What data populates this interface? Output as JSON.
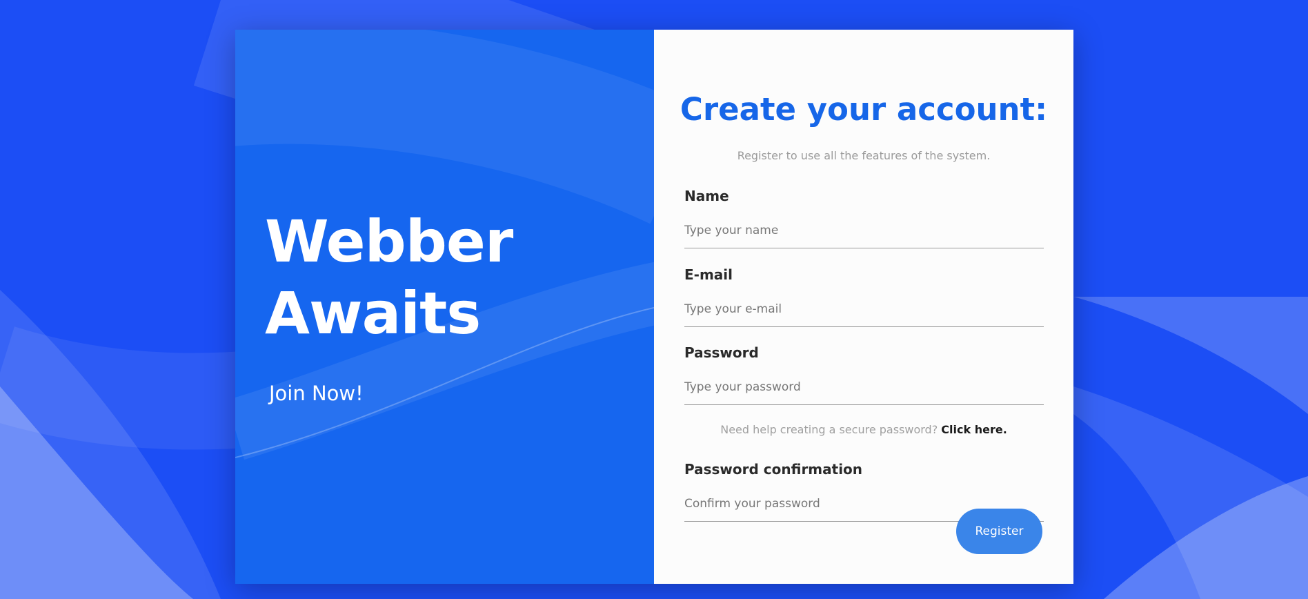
{
  "hero": {
    "title_line1": "Webber",
    "title_line2": "Awaits",
    "subtitle": "Join Now!"
  },
  "form": {
    "title": "Create your account:",
    "subtitle": "Register to use all the features of the system.",
    "fields": [
      {
        "label": "Name",
        "placeholder": "Type your name"
      },
      {
        "label": "E-mail",
        "placeholder": "Type your e-mail"
      },
      {
        "label": "Password",
        "placeholder": "Type your password"
      },
      {
        "label": "Password confirmation",
        "placeholder": "Confirm your password"
      }
    ],
    "password_help": {
      "text": "Need help creating a secure password?",
      "link": "Click here."
    },
    "submit_label": "Register"
  },
  "colors": {
    "background": "#1c4ef5",
    "panel_left": "#1666ef",
    "title_blue": "#1666e8",
    "button": "#3a85e9"
  }
}
